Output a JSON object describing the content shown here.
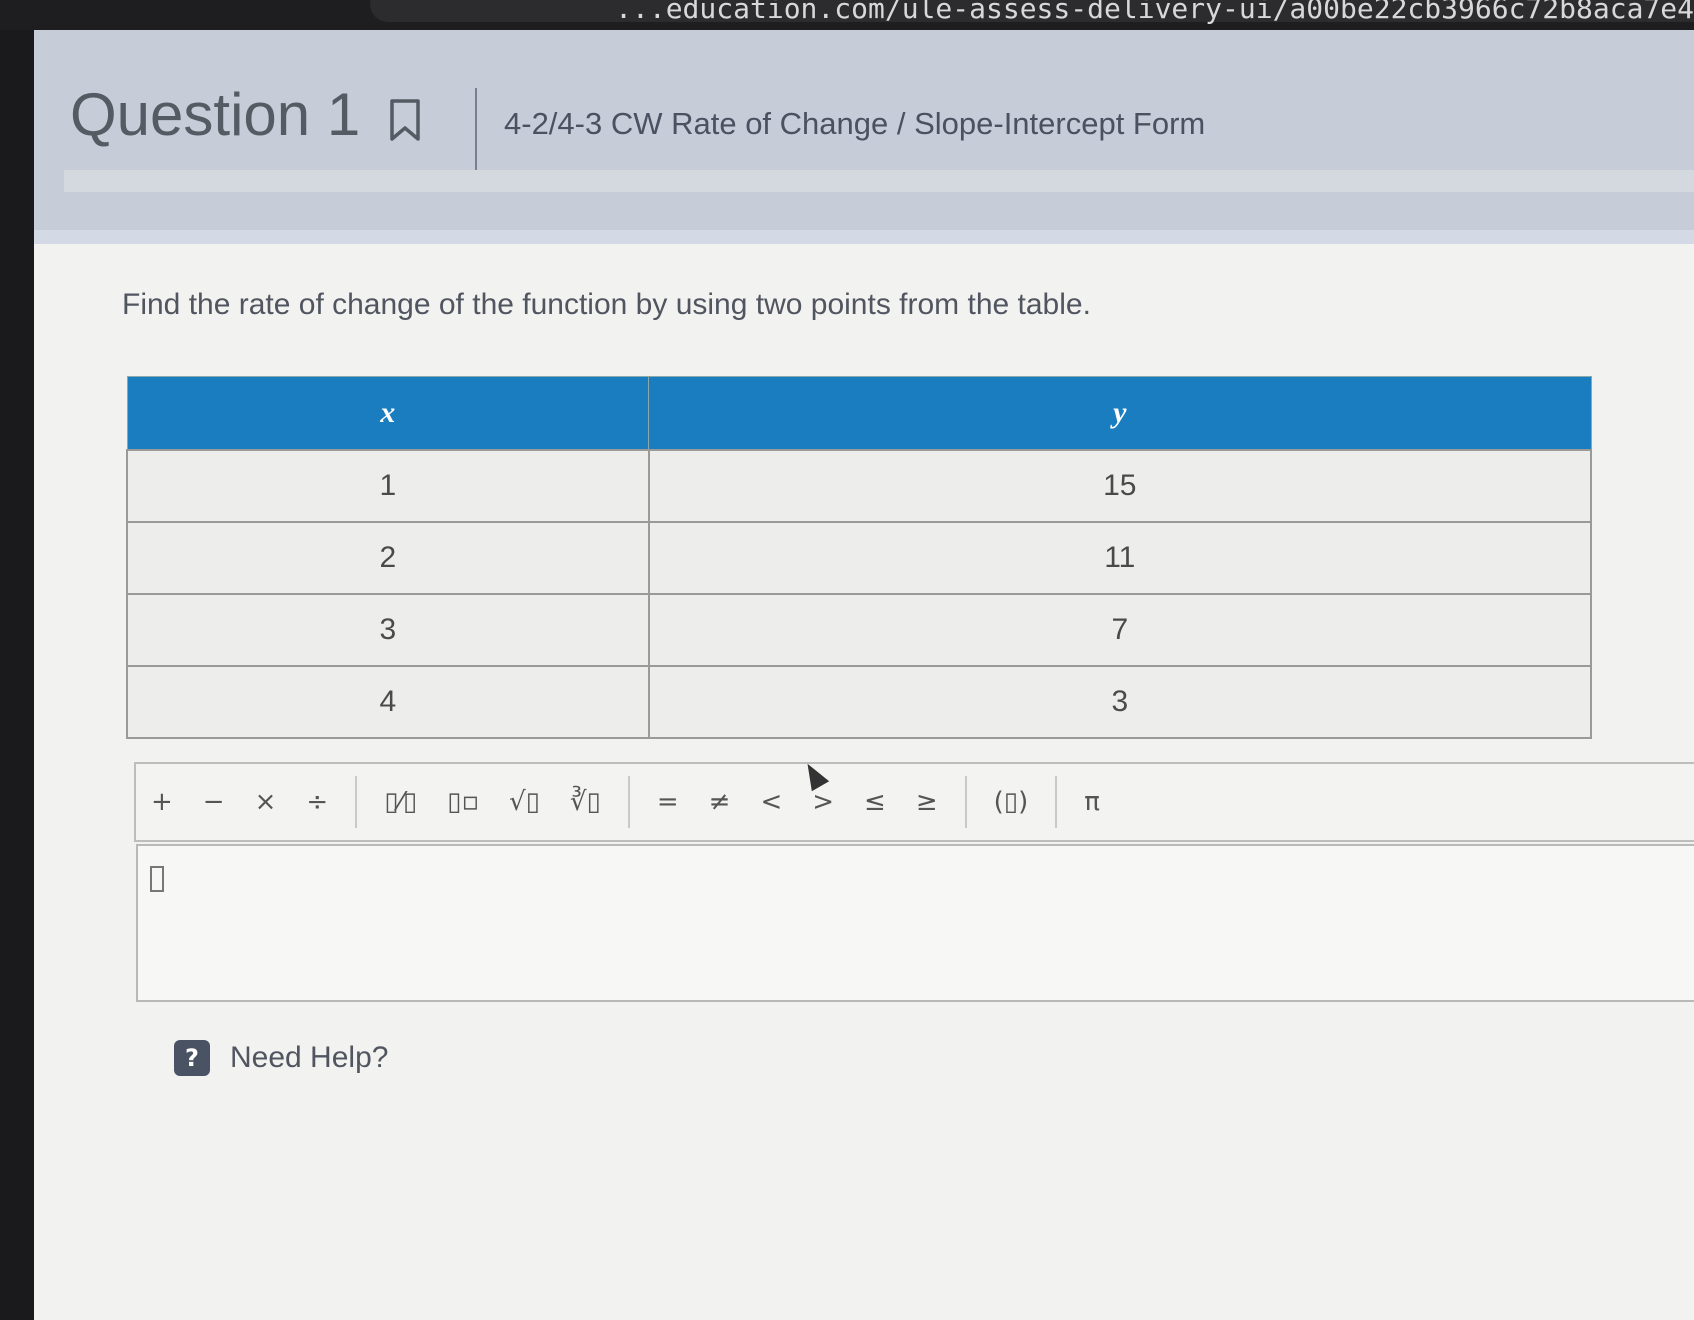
{
  "browser": {
    "url_fragment": "...education.com/ule-assess-delivery-ui/a00be22cb3966c72b8aca7e4"
  },
  "question": {
    "title": "Question 1",
    "assignment": "4-2/4-3 CW Rate of Change / Slope-Intercept Form",
    "prompt": "Find the rate of change of the function by using two points from the table."
  },
  "table": {
    "headers": [
      "x",
      "y"
    ],
    "rows": [
      [
        "1",
        "15"
      ],
      [
        "2",
        "11"
      ],
      [
        "3",
        "7"
      ],
      [
        "4",
        "3"
      ]
    ]
  },
  "toolbar": {
    "groups": [
      [
        {
          "name": "plus-button",
          "label": "+"
        },
        {
          "name": "minus-button",
          "label": "−"
        },
        {
          "name": "times-button",
          "label": "×"
        },
        {
          "name": "divide-button",
          "label": "÷"
        }
      ],
      [
        {
          "name": "fraction-button",
          "label": "▯⁄▯"
        },
        {
          "name": "exponent-button",
          "label": "▯▫"
        },
        {
          "name": "sqrt-button",
          "label": "√▯"
        },
        {
          "name": "nth-root-button",
          "label": "∛▯"
        }
      ],
      [
        {
          "name": "equals-button",
          "label": "="
        },
        {
          "name": "not-equal-button",
          "label": "≠"
        },
        {
          "name": "less-than-button",
          "label": "<"
        },
        {
          "name": "greater-than-button",
          "label": ">"
        },
        {
          "name": "less-equal-button",
          "label": "≤"
        },
        {
          "name": "greater-equal-button",
          "label": "≥"
        }
      ],
      [
        {
          "name": "parentheses-button",
          "label": "(▯)"
        }
      ],
      [
        {
          "name": "pi-button",
          "label": "π"
        }
      ]
    ]
  },
  "help": {
    "icon": "?",
    "label": "Need Help?"
  },
  "icons": {
    "bookmark": "bookmark-icon",
    "help": "help-icon"
  }
}
